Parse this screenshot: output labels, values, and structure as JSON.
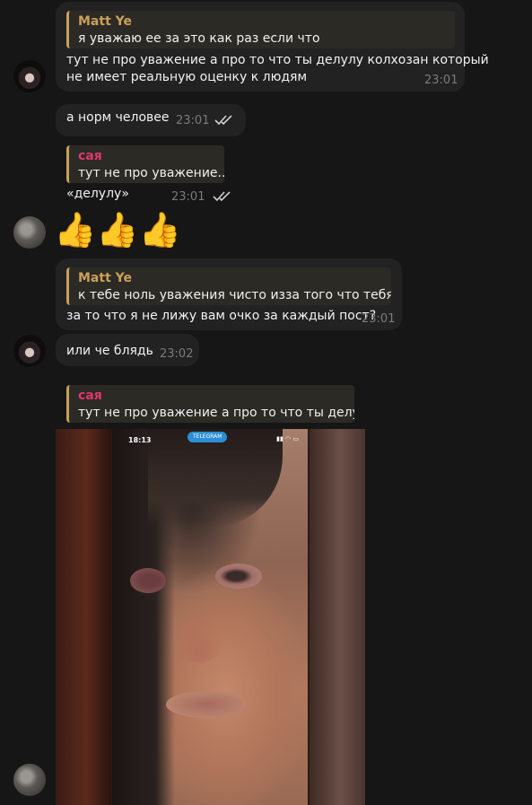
{
  "messages": {
    "m1": {
      "reply_name": "Matt Ye",
      "reply_text": "я уважаю ее за это как раз если что",
      "text_line1": "тут не про уважение а про то что ты делулу колхозан который",
      "text_line2": "не имеет реальную оценку к людям",
      "time": "23:01"
    },
    "m2": {
      "text": "а норм человее",
      "time": "23:01"
    },
    "m3": {
      "reply_name": "сая",
      "reply_text": "тут не про уважение...",
      "text": "«делулу»",
      "time": "23:01"
    },
    "m4": {
      "emoji": "👍👍👍"
    },
    "m5": {
      "reply_name": "Matt Ye",
      "reply_text": "к тебе ноль уважения чисто изза того что тебя ...",
      "text": "за то что я не лижу вам очко за каждый пост?",
      "time": "23:01"
    },
    "m6": {
      "text": "или че блядь",
      "time": "23:02"
    },
    "m7": {
      "reply_name": "сая",
      "reply_text": "тут не про уважение а про то что ты делу...",
      "photo": {
        "status_time": "18:13",
        "pill_label": "TELEGRAM",
        "status_icons": "▮▮ ◠ ▭"
      }
    }
  },
  "colors": {
    "background": "#161616",
    "bubble": "#222222",
    "reply_bar": "#c9a15a",
    "name_matt": "#c9a15a",
    "name_saya": "#e0366f",
    "time": "#7b7b7b"
  }
}
